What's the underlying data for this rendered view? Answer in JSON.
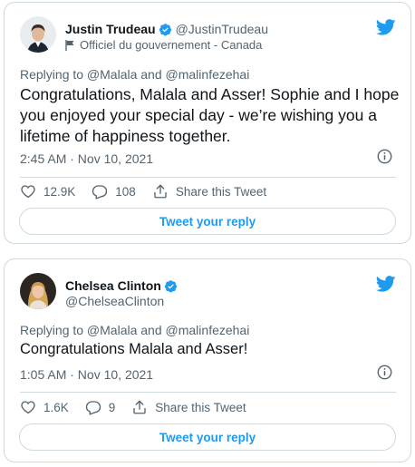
{
  "colors": {
    "accent": "#1d9bf0",
    "text": "#0f1419",
    "muted": "#536471",
    "border": "#cfd9de"
  },
  "tweets": [
    {
      "author": {
        "name": "Justin Trudeau",
        "handle": "@JustinTrudeau",
        "verified": true,
        "label": "Officiel du gouvernement - Canada",
        "label_icon": "flag-icon"
      },
      "reply_to": "Replying to @Malala and @malinfezehai",
      "text": "Congratulations, Malala and Asser! Sophie and I hope you enjoyed your special day - we’re wishing you a lifetime of happiness together.",
      "timestamp": "2:45 AM · Nov 10, 2021",
      "likes": "12.9K",
      "replies": "108",
      "share_label": "Share this Tweet",
      "reply_button": "Tweet your reply"
    },
    {
      "author": {
        "name": "Chelsea Clinton",
        "handle": "@ChelseaClinton",
        "verified": true
      },
      "reply_to": "Replying to @Malala and @malinfezehai",
      "text": "Congratulations Malala and Asser!",
      "timestamp": "1:05 AM · Nov 10, 2021",
      "likes": "1.6K",
      "replies": "9",
      "share_label": "Share this Tweet",
      "reply_button": "Tweet your reply"
    }
  ]
}
